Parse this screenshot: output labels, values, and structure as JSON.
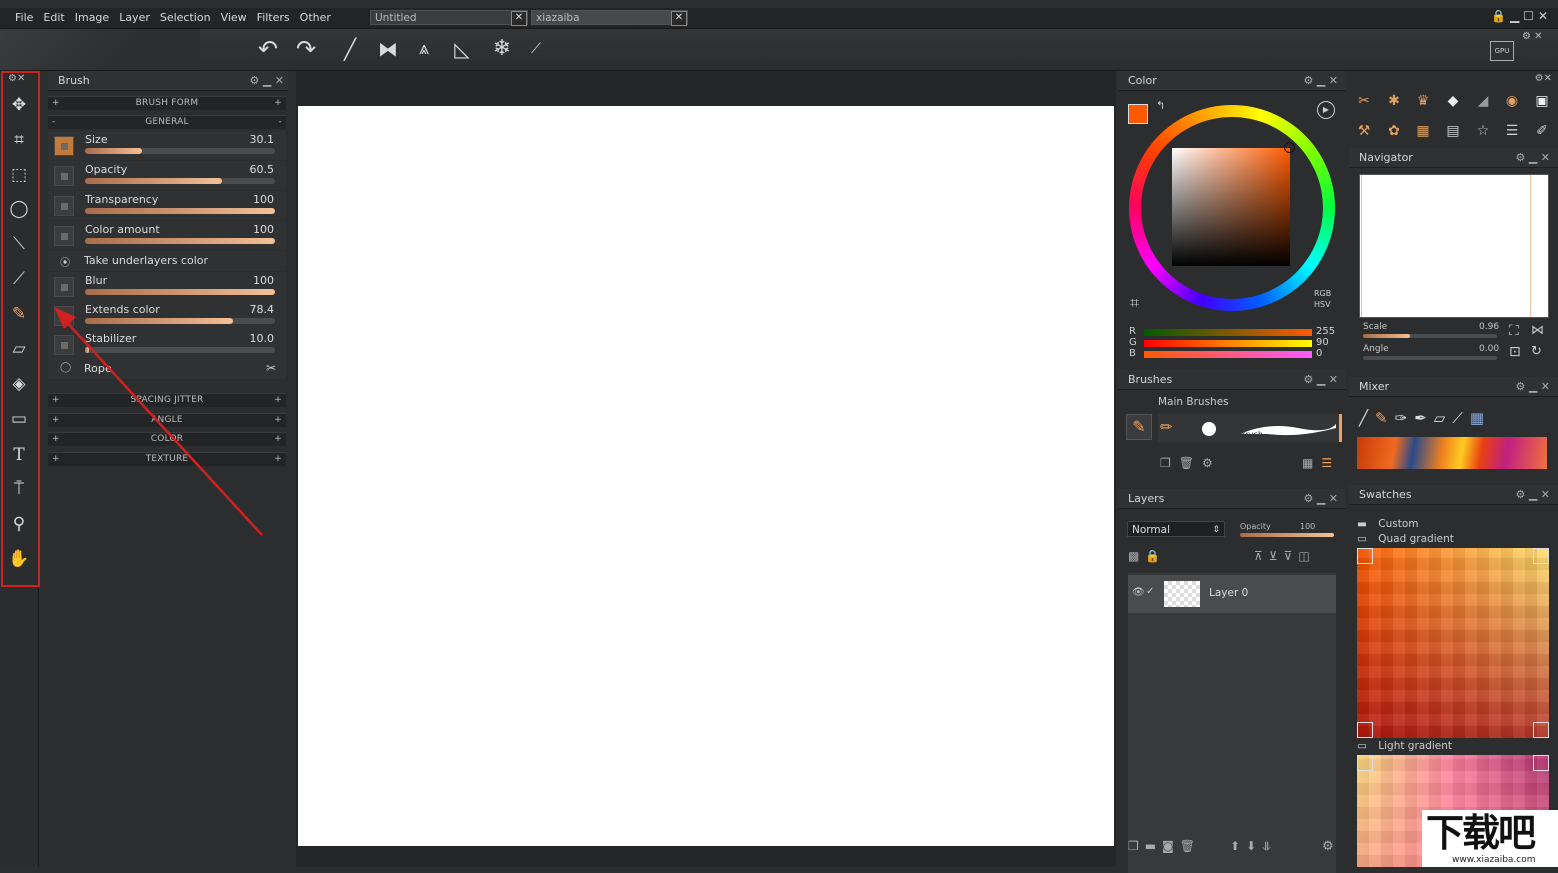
{
  "menu": [
    "File",
    "Edit",
    "Image",
    "Layer",
    "Selection",
    "View",
    "Filters",
    "Other"
  ],
  "tabs": [
    {
      "label": "Untitled"
    },
    {
      "label": "xiazaiba"
    }
  ],
  "brush_panel": {
    "title": "Brush",
    "sections_top": [
      {
        "label": "BRUSH FORM"
      },
      {
        "label": "GENERAL"
      }
    ],
    "params": [
      {
        "label": "Size",
        "value": "30.1",
        "fill": 0.3
      },
      {
        "label": "Opacity",
        "value": "60.5",
        "fill": 0.72
      },
      {
        "label": "Transparency",
        "value": "100",
        "fill": 1.0
      },
      {
        "label": "Color amount",
        "value": "100",
        "fill": 1.0
      }
    ],
    "take_underlayers": "Take underlayers color",
    "params2": [
      {
        "label": "Blur",
        "value": "100",
        "fill": 1.0
      },
      {
        "label": "Extends color",
        "value": "78.4",
        "fill": 0.78
      },
      {
        "label": "Stabilizer",
        "value": "10.0",
        "fill": 0.02
      }
    ],
    "rope": "Rope",
    "sections_bottom": [
      {
        "label": "SPACING JITTER"
      },
      {
        "label": "ANGLE"
      },
      {
        "label": "COLOR"
      },
      {
        "label": "TEXTURE"
      }
    ]
  },
  "color_panel": {
    "title": "Color",
    "rgb_label": "RGB",
    "hsv_label": "HSV",
    "channels": [
      {
        "name": "R",
        "value": "255"
      },
      {
        "name": "G",
        "value": "90"
      },
      {
        "name": "B",
        "value": "0"
      }
    ],
    "primary": "#ff5a00"
  },
  "brushes_panel": {
    "title": "Brushes",
    "group": "Main Brushes",
    "current": "Brush"
  },
  "layers_panel": {
    "title": "Layers",
    "blend": "Normal",
    "opacity_label": "Opacity",
    "opacity_value": "100",
    "layer_name": "Layer 0"
  },
  "navigator": {
    "title": "Navigator",
    "scale_label": "Scale",
    "scale_value": "0.96",
    "angle_label": "Angle",
    "angle_value": "0.00"
  },
  "mixer": {
    "title": "Mixer"
  },
  "swatches": {
    "title": "Swatches",
    "items": [
      {
        "label": "Custom"
      },
      {
        "label": "Quad gradient"
      },
      {
        "label": "Light gradient"
      }
    ]
  },
  "gpu_label": "GPU",
  "watermark": {
    "text": "下载吧",
    "url": "www.xiazaiba.com"
  }
}
